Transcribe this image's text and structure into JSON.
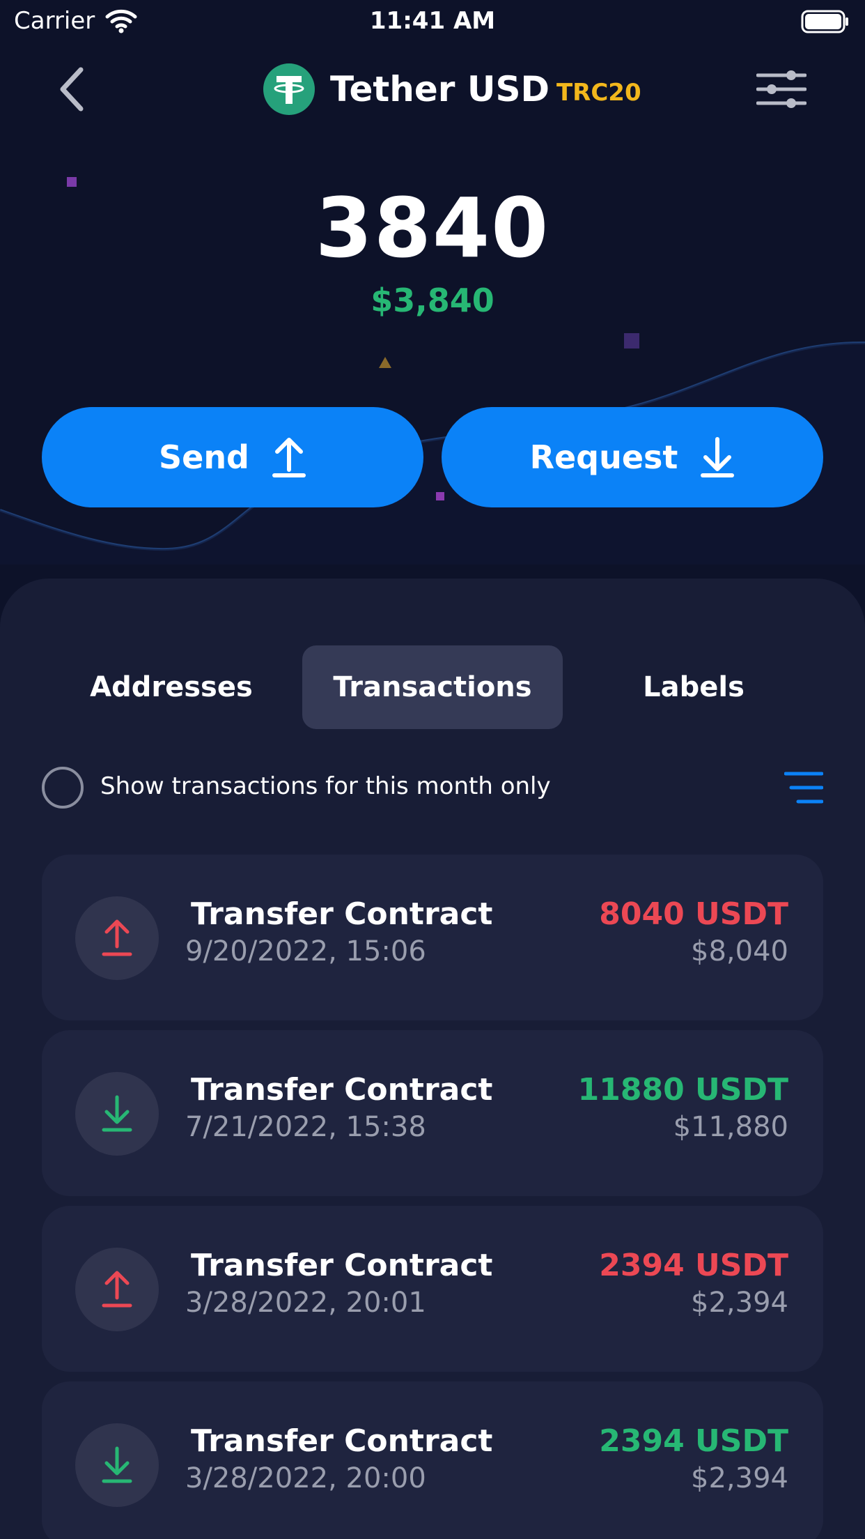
{
  "status_bar": {
    "carrier": "Carrier",
    "time": "11:41 AM"
  },
  "header": {
    "title": "Tether USD",
    "network": "TRC20"
  },
  "balance": {
    "amount": "3840",
    "usd": "$3,840"
  },
  "actions": {
    "send_label": "Send",
    "request_label": "Request"
  },
  "tabs": [
    {
      "label": "Addresses",
      "active": false
    },
    {
      "label": "Transactions",
      "active": true
    },
    {
      "label": "Labels",
      "active": false
    }
  ],
  "filter": {
    "label": "Show transactions for this month only",
    "checked": false
  },
  "transactions": [
    {
      "direction": "out",
      "title": "Transfer Contract",
      "date": "9/20/2022, 15:06",
      "amount": "8040 USDT",
      "usd": "$8,040"
    },
    {
      "direction": "in",
      "title": "Transfer Contract",
      "date": "7/21/2022, 15:38",
      "amount": "11880 USDT",
      "usd": "$11,880"
    },
    {
      "direction": "out",
      "title": "Transfer Contract",
      "date": "3/28/2022, 20:01",
      "amount": "2394 USDT",
      "usd": "$2,394"
    },
    {
      "direction": "in",
      "title": "Transfer Contract",
      "date": "3/28/2022, 20:00",
      "amount": "2394 USDT",
      "usd": "$2,394"
    }
  ],
  "colors": {
    "accent": "#0b82f7",
    "outgoing": "#ec4854",
    "incoming": "#27b774",
    "network": "#f2b71c",
    "tether": "#26a17b"
  },
  "icons": [
    "wifi-icon",
    "battery-icon",
    "back-chevron-icon",
    "tether-logo-icon",
    "settings-sliders-icon",
    "upload-arrow-icon",
    "download-arrow-icon",
    "radio-circle-icon",
    "sort-lines-icon"
  ]
}
